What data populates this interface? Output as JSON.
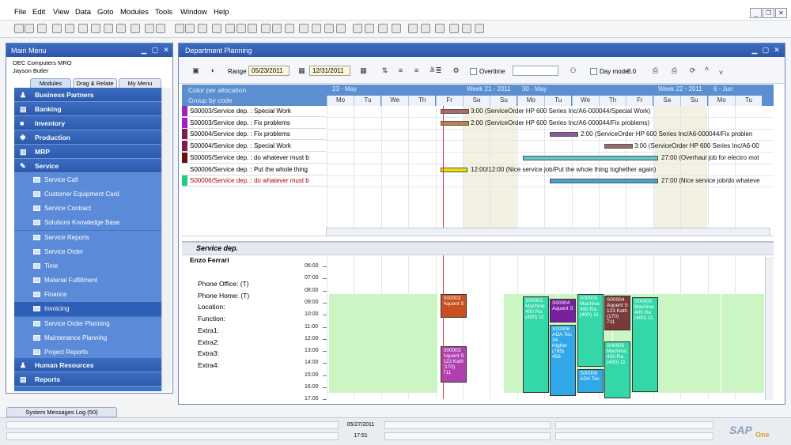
{
  "menubar": [
    "File",
    "Edit",
    "View",
    "Data",
    "Goto",
    "Modules",
    "Tools",
    "Window",
    "Help"
  ],
  "main_menu": {
    "title": "Main Menu",
    "company": "OEC Computers MRO",
    "user": "Jayson Butler",
    "tabs": [
      "Modules",
      "Drag & Relate",
      "My Menu"
    ],
    "groups_top": [
      "Business Partners",
      "Banking",
      "Inventory",
      "Production",
      "MRP",
      "Service"
    ],
    "service_items": [
      "Service Call",
      "Customer Equipment Card",
      "Service Contract",
      "Solutions Knowledge Base",
      "Service Reports",
      "Service Order",
      "Time",
      "Material Fulfillment",
      "Finance",
      "Invoicing",
      "Service Order Planning",
      "Maintenance Planning",
      "Project Reports"
    ],
    "groups_bottom": [
      "Human Resources",
      "Reports"
    ]
  },
  "planning": {
    "title": "Department Planning",
    "range_label": "Range",
    "range_from": "05/23/2011",
    "range_to": "12/31/2011",
    "overtime_label": "Overtime",
    "day_mode_label": "Day mode",
    "day_mode_value": "8.0",
    "header_line1": "Color per allocation",
    "header_line2": "Group by code",
    "week_labels": [
      "23 - May",
      "Week 21 - 2011",
      "30 - May",
      "Week 22 - 2011",
      "6 - Jun"
    ],
    "days": [
      "Mo",
      "Tu",
      "We",
      "Th",
      "Fr",
      "Sa",
      "Su",
      "Mo",
      "Tu",
      "We",
      "Th",
      "Fr",
      "Sa",
      "Su",
      "Mo",
      "Tu"
    ],
    "rows": [
      {
        "label": "S00003/Service dep. : Special Work",
        "color": "#a020c0",
        "text": "3:00 (ServiceOrder HP 600 Series Inc/A6-000044/Special Work)",
        "bar_color": "#b06a6a"
      },
      {
        "label": "S00003/Service dep. : Fix problems",
        "color": "#a020c0",
        "text": "2:00 (ServiceOrder HP 600 Series Inc/A6-000044/Fix problems)",
        "bar_color": "#c0804a"
      },
      {
        "label": "S00004/Service dep. : Fix problems",
        "color": "#7a1f4e",
        "text": "2:00 (ServiceOrder HP 600 Series Inc/A6-000044/Fix problen",
        "bar_color": "#8a5aa0"
      },
      {
        "label": "S00004/Service dep. : Special Work",
        "color": "#7a1f4e",
        "text": "3:00 (ServiceOrder HP 600 Series Inc/A6-00",
        "bar_color": "#9a6a6a"
      },
      {
        "label": "S00005/Service dep. : do whatever must b",
        "color": "#6a1010",
        "text": "27:00 (Overhaul job for electro mot",
        "bar_color": "#60c8c8"
      },
      {
        "label": "S00006/Service dep. : Put the whole thing",
        "color": "#ffffff",
        "text": "12:00/12:00 (Nice service job/Put the whole thing toghether again)",
        "bar_color": "#f0e000"
      },
      {
        "label": "S00006/Service dep. : do whatever must b",
        "color": "#20d080",
        "text": "27:00 (Nice service job/do whateve",
        "bar_color": "#4aa0d8"
      }
    ],
    "lower": {
      "department": "Service dep.",
      "employee": "Enzo Ferrari",
      "info": [
        "Phone Office: (T)",
        "Phone Home: (T)",
        "Location:",
        "Function:",
        "Extra1:",
        "Extra2:",
        "Extra3:",
        "Extra4:"
      ],
      "times": [
        "06:00",
        "07:00",
        "08:00",
        "09:00",
        "10:00",
        "11:00",
        "12:00",
        "13:00",
        "14:00",
        "15:00",
        "16:00",
        "17:00"
      ],
      "appointments": [
        {
          "text": "S00003 Aquent S",
          "color": "#c8501e"
        },
        {
          "text": "S00003 Aquent S 123 Kath (170) 711",
          "color": "#b040b0"
        },
        {
          "text": "S00002 Machina 400 Ra (400) 11",
          "color": "#34d8a8"
        },
        {
          "text": "S00004 Aquent S",
          "color": "#7a1fa0"
        },
        {
          "text": "S00006 ADA Tec 34 Higher (765) 456",
          "color": "#30a8e8"
        },
        {
          "text": "S00005 Machina 400 Ra (400) 11",
          "color": "#34d8a8"
        },
        {
          "text": "S00006 ADA Tec",
          "color": "#30a8e8"
        },
        {
          "text": "S00004 Aquent S 123 Kath (170) 711",
          "color": "#7a3a3a"
        },
        {
          "text": "S00005 Machina 400 Ra (400) 11",
          "color": "#34d8a8"
        },
        {
          "text": "S00005 Machina 400 Ra (400) 11",
          "color": "#34d8a8"
        }
      ]
    }
  },
  "status": {
    "system_messages": "System Messages Log (50)",
    "date": "05/27/2011",
    "time": "17:51",
    "brand": "SAP",
    "brand_sub": "One"
  }
}
